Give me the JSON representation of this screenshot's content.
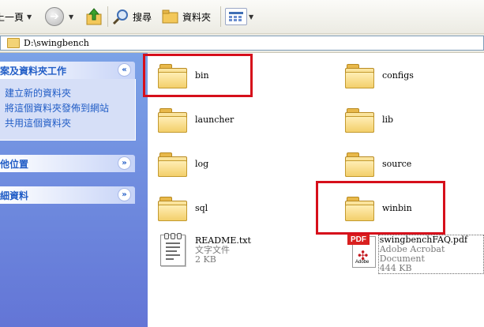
{
  "toolbar": {
    "back_label": "上一頁",
    "search_label": "搜尋",
    "folders_label": "資料夾"
  },
  "address": {
    "path": "D:\\swingbench"
  },
  "tasks": {
    "file_folder_tasks": {
      "title": "案及資料夾工作",
      "toggle": "«",
      "links": [
        "建立新的資料夾",
        "將這個資料夾發佈到網站",
        "共用這個資料夾"
      ]
    },
    "other_places": {
      "title": "他位置",
      "toggle": "»"
    },
    "details": {
      "title": "細資料",
      "toggle": "»"
    }
  },
  "folders": [
    {
      "name": "bin"
    },
    {
      "name": "configs"
    },
    {
      "name": "launcher"
    },
    {
      "name": "lib"
    },
    {
      "name": "log"
    },
    {
      "name": "source"
    },
    {
      "name": "sql"
    },
    {
      "name": "winbin"
    }
  ],
  "files": [
    {
      "name": "README.txt",
      "type": "文字文件",
      "size": "2 KB"
    },
    {
      "name": "swingbenchFAQ.pdf",
      "type": "Adobe Acrobat Document",
      "size": "444 KB"
    }
  ],
  "pdf_badge": "PDF",
  "pdf_brand": "Adobe",
  "colors": {
    "highlight": "#d60f1b",
    "task_pane": "#7ba2e7",
    "link": "#215dc6"
  }
}
